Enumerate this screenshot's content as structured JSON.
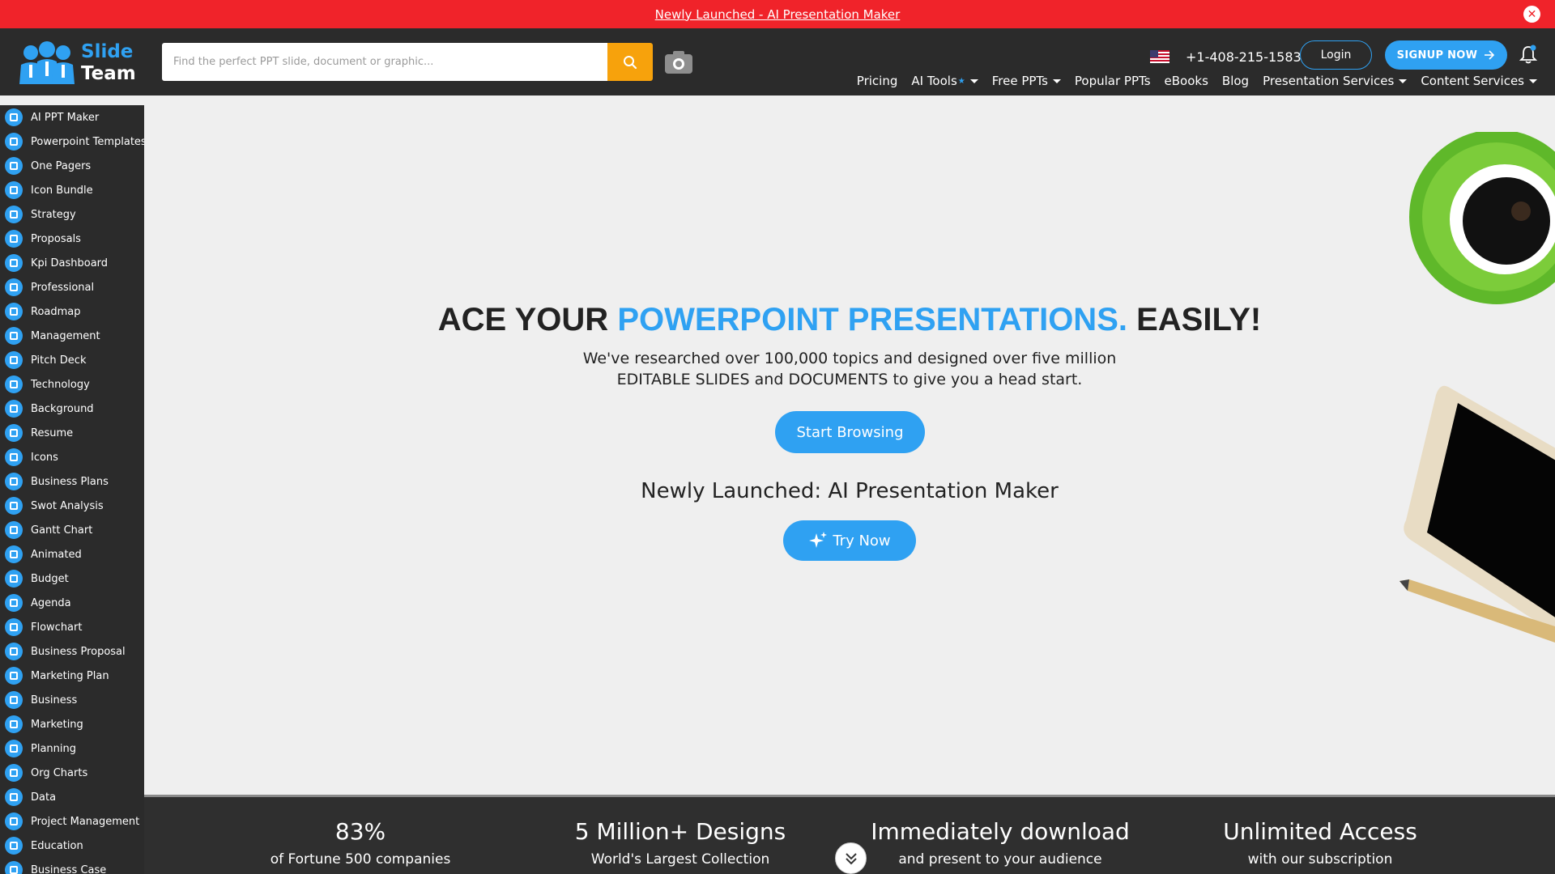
{
  "announcement": {
    "link_text": "Newly Launched - AI Presentation Maker",
    "close_icon": "close-icon"
  },
  "header": {
    "logo_line1": "Slide",
    "logo_line2": "Team",
    "search_placeholder": "Find the perfect PPT slide, document or graphic...",
    "phone": "+1-408-215-1583",
    "login_label": "Login",
    "signup_label": "SIGNUP NOW",
    "nav": [
      {
        "label": "Pricing"
      },
      {
        "label": "AI Tools"
      },
      {
        "label": "Free PPTs"
      },
      {
        "label": "Popular PPTs"
      },
      {
        "label": "eBooks"
      },
      {
        "label": "Blog"
      },
      {
        "label": "Presentation Services"
      },
      {
        "label": "Content Services"
      }
    ]
  },
  "sidebar": {
    "items": [
      {
        "label": "AI PPT Maker"
      },
      {
        "label": "Powerpoint Templates"
      },
      {
        "label": "One Pagers"
      },
      {
        "label": "Icon Bundle"
      },
      {
        "label": "Strategy"
      },
      {
        "label": "Proposals"
      },
      {
        "label": "Kpi Dashboard"
      },
      {
        "label": "Professional"
      },
      {
        "label": "Roadmap"
      },
      {
        "label": "Management"
      },
      {
        "label": "Pitch Deck"
      },
      {
        "label": "Technology"
      },
      {
        "label": "Background"
      },
      {
        "label": "Resume"
      },
      {
        "label": "Icons"
      },
      {
        "label": "Business Plans"
      },
      {
        "label": "Swot Analysis"
      },
      {
        "label": "Gantt Chart"
      },
      {
        "label": "Animated"
      },
      {
        "label": "Budget"
      },
      {
        "label": "Agenda"
      },
      {
        "label": "Flowchart"
      },
      {
        "label": "Business Proposal"
      },
      {
        "label": "Marketing Plan"
      },
      {
        "label": "Business"
      },
      {
        "label": "Marketing"
      },
      {
        "label": "Planning"
      },
      {
        "label": "Org Charts"
      },
      {
        "label": "Data"
      },
      {
        "label": "Project Management"
      },
      {
        "label": "Education"
      },
      {
        "label": "Business Case"
      }
    ]
  },
  "hero": {
    "headline_part1": "ACE YOUR ",
    "headline_highlight": "POWERPOINT PRESENTATIONS.",
    "headline_part2": " EASILY!",
    "subtext_line1": "We've researched over 100,000 topics and designed over five million",
    "subtext_line2": "EDITABLE SLIDES and DOCUMENTS to give you a head start.",
    "browse_label": "Start Browsing",
    "newly_text": "Newly Launched: AI Presentation Maker",
    "try_label": "Try Now"
  },
  "stats": [
    {
      "big": "83%",
      "small": "of Fortune 500 companies"
    },
    {
      "big": "5 Million+ Designs",
      "small": "World's Largest Collection"
    },
    {
      "big": "Immediately download",
      "small": "and present to your audience"
    },
    {
      "big": "Unlimited Access",
      "small": "with our subscription"
    }
  ],
  "colors": {
    "accent": "#2fa1f2",
    "announce_bg": "#f0232a",
    "header_bg": "#2b2b2b",
    "search_button": "#f7a20c"
  }
}
